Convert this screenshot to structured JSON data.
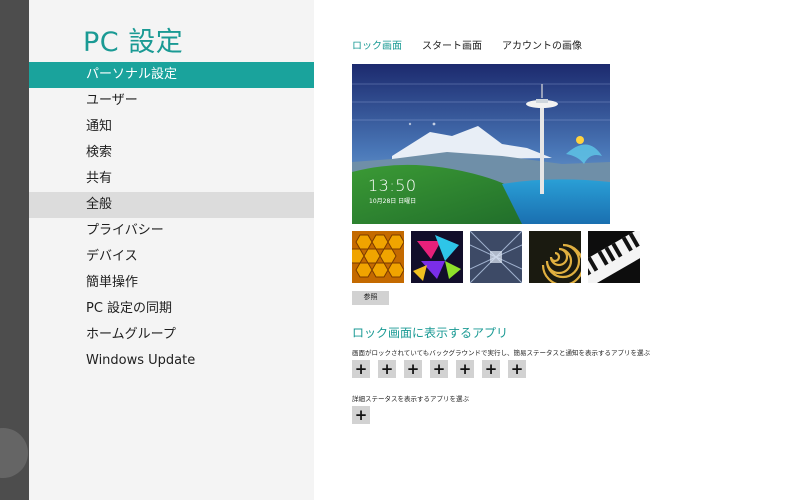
{
  "app": {
    "title": "PC 設定"
  },
  "nav": {
    "items": [
      {
        "label": "パーソナル設定",
        "state": "selected"
      },
      {
        "label": "ユーザー"
      },
      {
        "label": "通知"
      },
      {
        "label": "検索"
      },
      {
        "label": "共有"
      },
      {
        "label": "全般",
        "state": "hover"
      },
      {
        "label": "プライバシー"
      },
      {
        "label": "デバイス"
      },
      {
        "label": "簡単操作"
      },
      {
        "label": "PC 設定の同期"
      },
      {
        "label": "ホームグループ"
      },
      {
        "label": "Windows Update"
      }
    ]
  },
  "tabs": [
    {
      "label": "ロック画面",
      "active": true
    },
    {
      "label": "スタート画面"
    },
    {
      "label": "アカウントの画像"
    }
  ],
  "lock_screen": {
    "time": "13:50",
    "date": "10月28日 日曜日"
  },
  "thumbnails": [
    {
      "icon": "honeycomb-image"
    },
    {
      "icon": "colorful-shapes-image"
    },
    {
      "icon": "tunnel-image"
    },
    {
      "icon": "nautilus-shell-image"
    },
    {
      "icon": "piano-keys-image"
    }
  ],
  "browse_label": "参照",
  "lock_apps": {
    "title": "ロック画面に表示するアプリ",
    "description": "画面がロックされていてもバックグラウンドで実行し、簡易ステータスと通知を表示するアプリを選ぶ",
    "slots": [
      "+",
      "+",
      "+",
      "+",
      "+",
      "+",
      "+"
    ],
    "detail_description": "詳細ステータスを表示するアプリを選ぶ",
    "detail_slot": "+"
  },
  "colors": {
    "accent": "#1aa39c",
    "nav_background": "#f4f4f4",
    "hover": "#dcdcdc",
    "button": "#d2d2d2"
  }
}
